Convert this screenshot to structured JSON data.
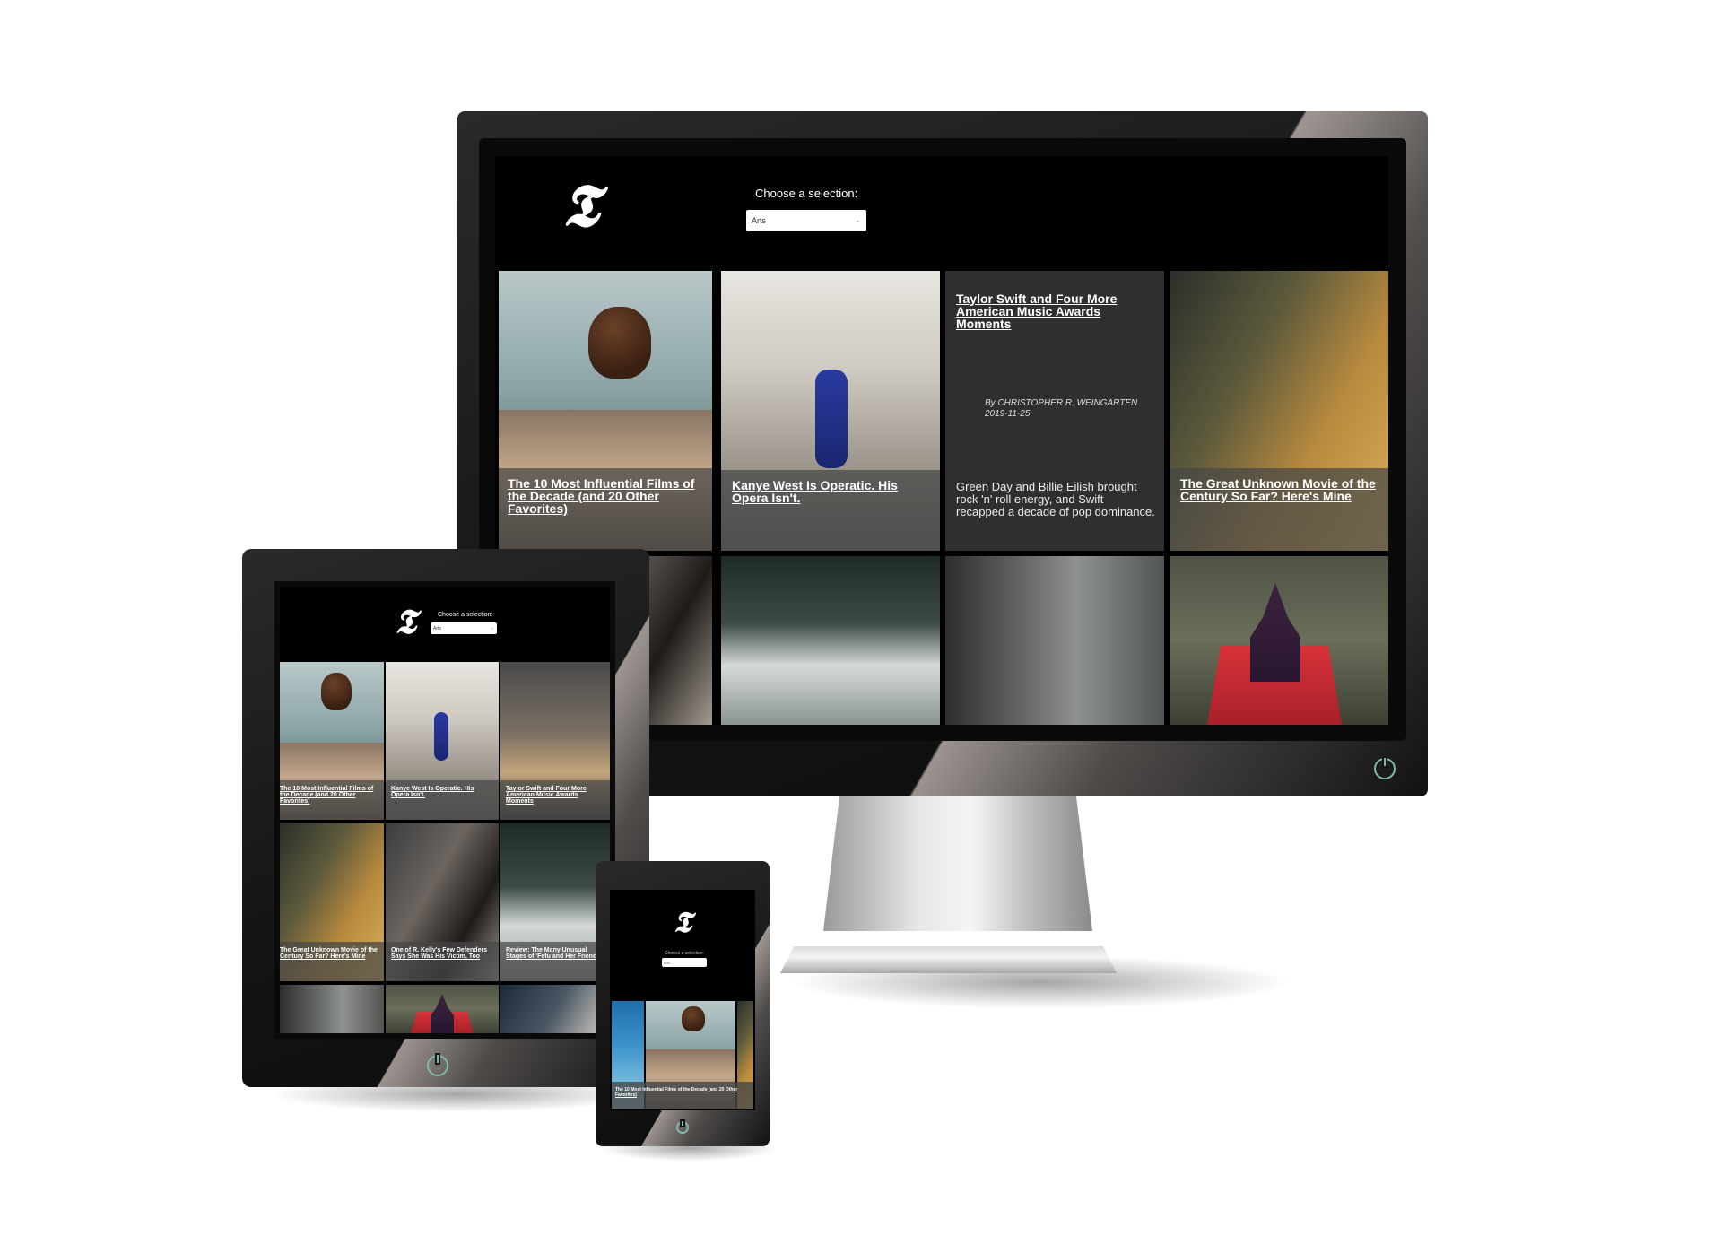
{
  "app": {
    "logo_glyph": "𝕿",
    "selection_label": "Choose a selection:",
    "selection_value": "Arts"
  },
  "desktop": {
    "tiles": [
      {
        "title": "The 10 Most Influential Films of the Decade (and 20 Other Favorites)"
      },
      {
        "title": "Kanye West Is Operatic. His Opera Isn't."
      },
      {
        "title": "Taylor Swift and Four More American Music Awards Moments",
        "byline": "By CHRISTOPHER R. WEINGARTEN",
        "date": "2019-11-25",
        "abstract": "Green Day and Billie Eilish brought rock 'n' roll energy, and Swift recapped a decade of pop dominance."
      },
      {
        "title": "The Great Unknown Movie of the Century So Far? Here's Mine"
      }
    ]
  },
  "tablet": {
    "tiles": [
      {
        "title": "The 10 Most Influential Films of the Decade (and 20 Other Favorites)"
      },
      {
        "title": "Kanye West Is Operatic. His Opera Isn't."
      },
      {
        "title": "Taylor Swift and Four More American Music Awards Moments"
      },
      {
        "title": "The Great Unknown Movie of the Century So Far? Here's Mine"
      },
      {
        "title": "One of R. Kelly's Few Defenders Says She Was His Victim, Too"
      },
      {
        "title": "Review: The Many Unusual Stages of 'Fefu and Her Friends'"
      }
    ]
  },
  "phone": {
    "selection_value": "Arts",
    "tiles": [
      {
        "title": "The 10 Most Influential Films of the Decade (and 20 Other Favorites)"
      }
    ]
  },
  "colors": {
    "bezel": "#141414",
    "screen": "#000000",
    "caption_bg": "#464646",
    "power_ring": "#7fb8a8"
  }
}
